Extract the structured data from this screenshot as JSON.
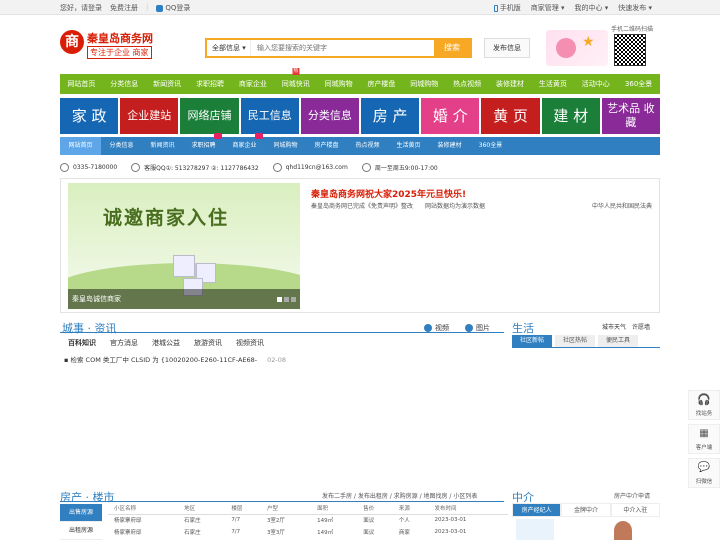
{
  "topbar": {
    "greeting": "您好，请登录",
    "register": "免费注册",
    "qq_login": "QQ登录",
    "mobile": "手机版",
    "merchant": "商家管理",
    "my_center": "我的中心",
    "quick_post": "快速发布"
  },
  "logo": {
    "seal": "商",
    "name": "秦皇岛商务网",
    "slogan": "专注于企业 商家"
  },
  "search": {
    "category": "全部信息",
    "placeholder": "输入您要搜索的关键字",
    "button": "搜索"
  },
  "post_button": "发布信息",
  "qr_caption": "手机二维码扫描",
  "nav_main": [
    "网站首页",
    "分类信息",
    "新闻资讯",
    "求职招聘",
    "商家企业",
    "同城快讯",
    "同城购物",
    "房产楼盘",
    "同城购物",
    "热点视频",
    "装修建材",
    "生活黄页",
    "活动中心",
    "360全景"
  ],
  "nav_main_hot_index": 5,
  "categories": [
    {
      "label": "家 政",
      "color": "#1667b3",
      "cls": ""
    },
    {
      "label": "企业建站",
      "color": "#c51e1e",
      "cls": "small"
    },
    {
      "label": "网络店铺",
      "color": "#1b7f3a",
      "cls": "small"
    },
    {
      "label": "民工信息",
      "color": "#1667b3",
      "cls": "small"
    },
    {
      "label": "分类信息",
      "color": "#8a2a99",
      "cls": "small"
    },
    {
      "label": "房 产",
      "color": "#1667b3",
      "cls": ""
    },
    {
      "label": "婚 介",
      "color": "#e4408a",
      "cls": ""
    },
    {
      "label": "黄 页",
      "color": "#c51e1e",
      "cls": ""
    },
    {
      "label": "建 材",
      "color": "#1b7f3a",
      "cls": ""
    },
    {
      "label": "艺术品 收藏",
      "color": "#8a2a99",
      "cls": "stack"
    }
  ],
  "nav_sub": [
    "网站首页",
    "分类信息",
    "新闻资讯",
    "求职招聘",
    "商家企业",
    "同城购物",
    "房产楼盘",
    "热点视频",
    "生活黄页",
    "装修建材",
    "360全景"
  ],
  "info": {
    "phone": "0335-7180000",
    "qq_label": "客服QQ①: 513278297 ②: 1127786432",
    "email": "qhd119cn@163.com",
    "hours": "周一至周五9:00-17:00"
  },
  "slider": {
    "headline": "诚邀商家入住",
    "caption": "秦皇岛诚信商家"
  },
  "news": {
    "top": "秦皇岛商务网祝大家2025年元旦快乐!",
    "sub1": "秦皇岛商务网已完成《免责声明》整改",
    "sub2": "网站数据均为演示数据",
    "sub3": "中华人民共和国民法典"
  },
  "city_news": {
    "title": "城事 · 资讯",
    "video": "视频",
    "photo": "图片",
    "tabs": [
      "百科知识",
      "官方消息",
      "港城公益",
      "旅游资讯",
      "视频资讯"
    ],
    "item": "检索 COM 类工厂中 CLSID 为 {10020200-E260-11CF-AE68-",
    "date": "02-08"
  },
  "life": {
    "title": "生活",
    "weather": "城市天气",
    "complaint": "许愿墙",
    "tabs": [
      "社区新帖",
      "社区热帖",
      "便民工具"
    ]
  },
  "float_bar": [
    {
      "label": "找站务"
    },
    {
      "label": "客户端"
    },
    {
      "label": "扫微信"
    }
  ],
  "house": {
    "title": "房产 · 楼市",
    "links": "发布二手房 / 发布出租房 / 求购房源 / 地图找房 / 小区列表",
    "side": [
      "出售房源",
      "出租房源"
    ],
    "columns": [
      "小区名称",
      "地区",
      "楼层",
      "户型",
      "面积",
      "售价",
      "来源",
      "发布时间"
    ],
    "rows": [
      [
        "杨家寨府邸",
        "石家庄",
        "7/7",
        "3室2厅",
        "149㎡",
        "面议",
        "个人",
        "2023-03-01"
      ],
      [
        "杨家寨府邸",
        "石家庄",
        "7/7",
        "3室3厅",
        "149㎡",
        "面议",
        "商家",
        "2023-03-01"
      ]
    ]
  },
  "agency": {
    "title": "中介",
    "link": "房产中介申请",
    "tabs": [
      "房产经纪人",
      "金牌中介",
      "中介入驻"
    ]
  }
}
